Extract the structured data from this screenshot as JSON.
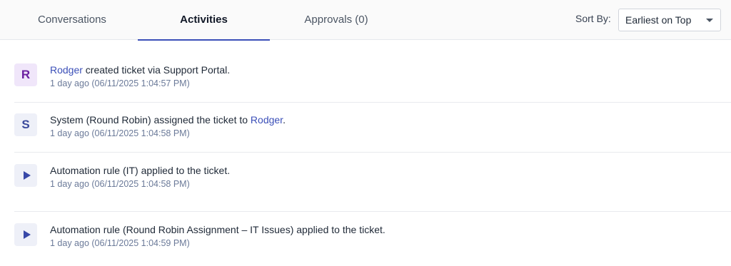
{
  "tabs": [
    {
      "label": "Conversations"
    },
    {
      "label": "Activities"
    },
    {
      "label": "Approvals (0)"
    }
  ],
  "sort": {
    "label": "Sort By:",
    "value": "Earliest on Top"
  },
  "activities": [
    {
      "avatar": "R",
      "actor": "Rodger",
      "text": " created ticket via Support Portal.",
      "time": "1 day ago (06/11/2025 1:04:57 PM)"
    },
    {
      "avatar": "S",
      "text_pre": "System (Round Robin) assigned the ticket to ",
      "assignee": "Rodger",
      "text_post": ".",
      "time": "1 day ago (06/11/2025 1:04:58 PM)"
    },
    {
      "avatar_icon": "play-icon",
      "text": "Automation rule (IT) applied to the ticket.",
      "time": "1 day ago (06/11/2025 1:04:58 PM)"
    },
    {
      "avatar_icon": "play-icon",
      "text": "Automation rule (Round Robin Assignment – IT Issues) applied to the ticket.",
      "time": "1 day ago (06/11/2025 1:04:59 PM)"
    }
  ]
}
